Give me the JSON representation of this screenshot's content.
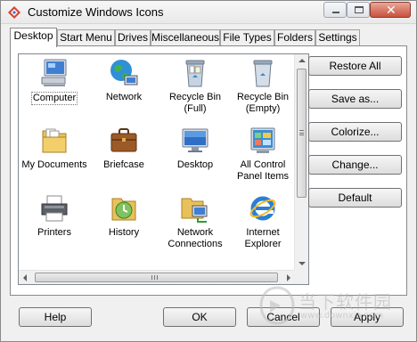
{
  "window": {
    "title": "Customize Windows Icons"
  },
  "tabs": [
    {
      "label": "Desktop",
      "active": true
    },
    {
      "label": "Start Menu"
    },
    {
      "label": "Drives"
    },
    {
      "label": "Miscellaneous"
    },
    {
      "label": "File Types"
    },
    {
      "label": "Folders"
    },
    {
      "label": "Settings"
    }
  ],
  "icons": [
    {
      "label": "Computer",
      "icon": "computer-icon",
      "selected": true
    },
    {
      "label": "Network",
      "icon": "network-icon"
    },
    {
      "label": "Recycle Bin\n(Full)",
      "icon": "recycle-bin-full-icon"
    },
    {
      "label": "Recycle Bin\n(Empty)",
      "icon": "recycle-bin-empty-icon"
    },
    {
      "label": "My Documents",
      "icon": "my-documents-icon"
    },
    {
      "label": "Briefcase",
      "icon": "briefcase-icon"
    },
    {
      "label": "Desktop",
      "icon": "desktop-icon"
    },
    {
      "label": "All Control\nPanel Items",
      "icon": "control-panel-icon"
    },
    {
      "label": "Printers",
      "icon": "printers-icon"
    },
    {
      "label": "History",
      "icon": "history-icon"
    },
    {
      "label": "Network\nConnections",
      "icon": "network-connections-icon"
    },
    {
      "label": "Internet\nExplorer",
      "icon": "internet-explorer-icon"
    }
  ],
  "side_buttons": {
    "restore_all": "Restore All",
    "save_as": "Save as...",
    "colorize": "Colorize...",
    "change": "Change...",
    "default": "Default"
  },
  "bottom_buttons": {
    "help": "Help",
    "ok": "OK",
    "cancel": "Cancel",
    "apply": "Apply"
  },
  "watermark": {
    "text": "当下软件园",
    "url": "www.downxia.com"
  }
}
